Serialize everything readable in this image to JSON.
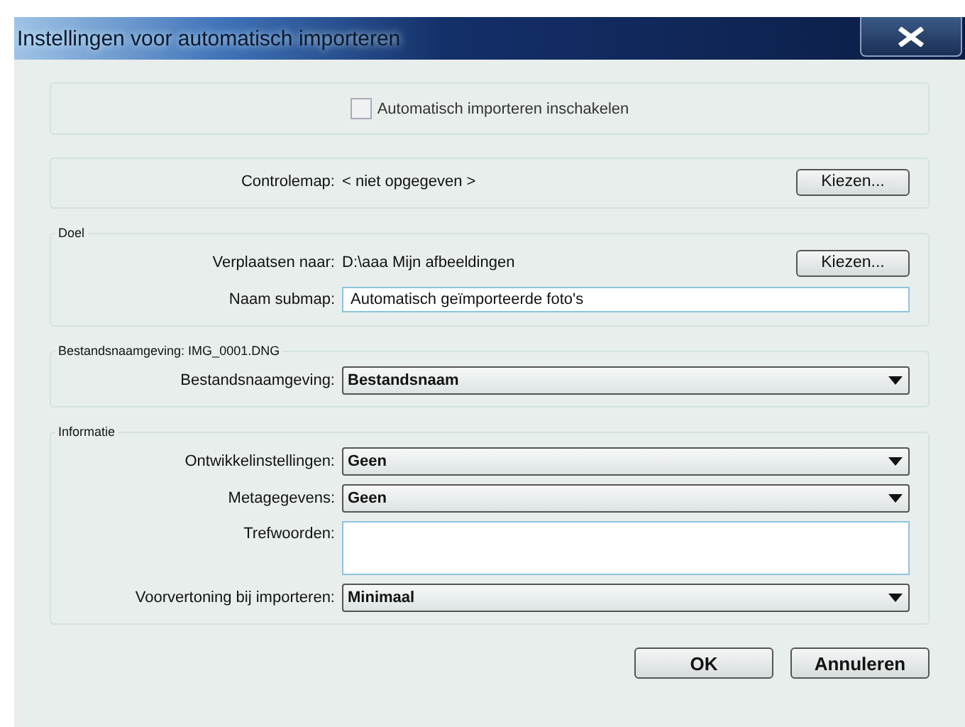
{
  "window": {
    "title": "Instellingen voor automatisch importeren"
  },
  "sections": [
    {
      "rows": [
        {
          "kind": "checkbox",
          "label": "Automatisch importeren inschakelen",
          "checked": false
        }
      ]
    },
    {
      "rows": [
        {
          "kind": "text",
          "label": "Controlemap:",
          "value": "< niet opgegeven >",
          "button": "Kiezen..."
        }
      ]
    },
    {
      "title": "Doel",
      "rows": [
        {
          "kind": "text",
          "label": "Verplaatsen naar:",
          "value": "D:\\aaa Mijn afbeeldingen",
          "button": "Kiezen..."
        },
        {
          "kind": "input",
          "label": "Naam submap:",
          "value": "Automatisch geïmporteerde foto's"
        }
      ]
    },
    {
      "title": "Bestandsnaamgeving: IMG_0001.DNG",
      "rows": [
        {
          "kind": "dropdown",
          "label": "Bestandsnaamgeving:",
          "value": "Bestandsnaam"
        }
      ]
    },
    {
      "title": "Informatie",
      "rows": [
        {
          "kind": "dropdown",
          "label": "Ontwikkelinstellingen:",
          "value": "Geen"
        },
        {
          "kind": "dropdown",
          "label": "Metagegevens:",
          "value": "Geen"
        },
        {
          "kind": "textarea",
          "label": "Trefwoorden:"
        },
        {
          "kind": "dropdown",
          "label": "Voorvertoning bij importeren:",
          "value": "Minimaal"
        }
      ]
    }
  ],
  "buttons": [
    "OK",
    "Annuleren"
  ]
}
